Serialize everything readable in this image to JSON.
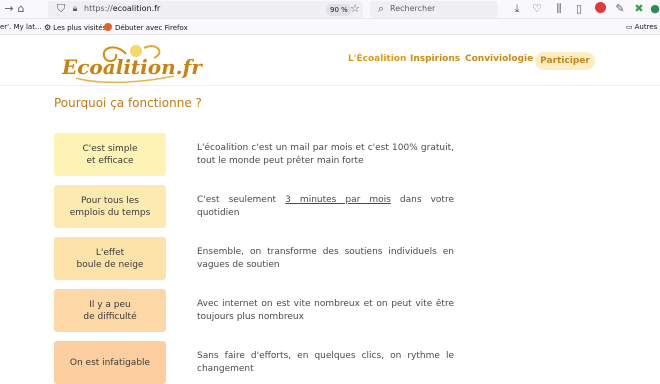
{
  "browser": {
    "url_prefix": "https://",
    "url_domain": "ecoalition.fr",
    "zoom": "90 %",
    "search_placeholder": "Rechercher",
    "bookmarks": [
      {
        "label": "er'. My lat..."
      },
      {
        "label": "Les plus visités"
      },
      {
        "label": "Débuter avec Firefox"
      },
      {
        "label": "Autres"
      }
    ]
  },
  "site": {
    "logo_text": "Ecoalition.fr",
    "nav": [
      {
        "label": "L'Écoalition"
      },
      {
        "label": "Inspirions"
      },
      {
        "label": "Conviviologie"
      }
    ],
    "cta_label": "Participer"
  },
  "content": {
    "section_title": "Pourquoi ça fonctionne ?",
    "rows": [
      {
        "card": "C'est simple\net efficace",
        "desc": "L'écoalition c'est un mail par mois et c'est 100% gratuit, tout le monde peut prêter main forte",
        "color": "#fdf3b5"
      },
      {
        "card": "Pour tous les\nemplois du temps",
        "desc_before": "C'est seulement ",
        "desc_link": "3 minutes par mois",
        "desc_after": " dans votre quotidien",
        "color": "#fdeab0"
      },
      {
        "card": "L'effet\nboule de neige",
        "desc": "Ensemble, on transforme des soutiens individuels en vagues de soutien",
        "color": "#fde2aa"
      },
      {
        "card": "Il y a peu\nde difficulté",
        "desc": "Avec internet on est vite nombreux et on peut vite être toujours plus nombreux",
        "color": "#fdd8a6"
      },
      {
        "card": "On est infatigable",
        "desc": "Sans faire d'efforts, en quelques clics, on rythme le changement",
        "color": "#fdcfa0"
      }
    ]
  }
}
